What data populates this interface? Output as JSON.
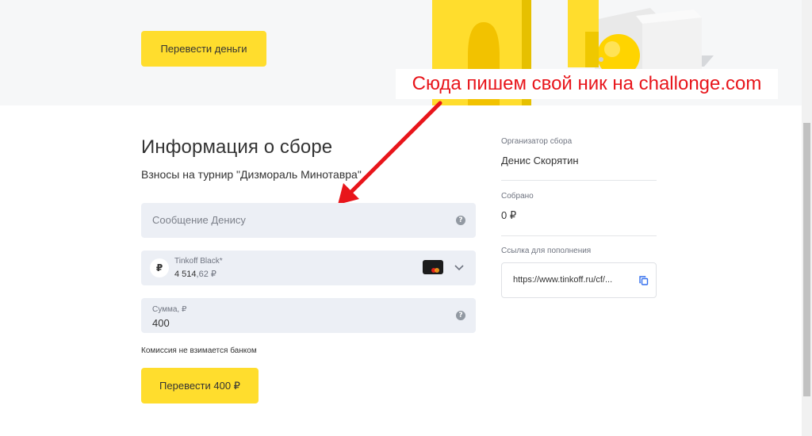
{
  "hero": {
    "transfer_button": "Перевести деньги"
  },
  "annotation": {
    "callout_text": "Сюда пишем свой ник на challonge.com",
    "color": "#e8151b"
  },
  "main": {
    "title": "Информация о сборе",
    "subtitle": "Взносы на турнир \"Дизмораль Минотавра\"",
    "message_field": {
      "placeholder": "Сообщение Денису",
      "help_icon": "question-icon"
    },
    "card_select": {
      "currency_symbol": "₽",
      "card_name": "Tinkoff Black*",
      "balance_main": "4 514",
      "balance_kop": ",62 ₽",
      "card_icon": "mastercard-card-icon",
      "expand_icon": "chevron-down-icon"
    },
    "amount_field": {
      "label": "Сумма, ₽",
      "value": "400",
      "help_icon": "question-icon"
    },
    "commission_note": "Комиссия не взимается банком",
    "pay_button": "Перевести 400 ₽"
  },
  "sidebar": {
    "organizer_label": "Организатор сбора",
    "organizer_name": "Денис Скорятин",
    "collected_label": "Собрано",
    "collected_value": "0 ₽",
    "link_label": "Ссылка для пополнения",
    "link_value": "https://www.tinkoff.ru/cf/...",
    "copy_icon": "copy-icon"
  },
  "colors": {
    "accent_yellow": "#ffdd2d",
    "field_bg": "#eceff5",
    "hero_bg": "#f6f7f8",
    "link_blue": "#336fee"
  }
}
